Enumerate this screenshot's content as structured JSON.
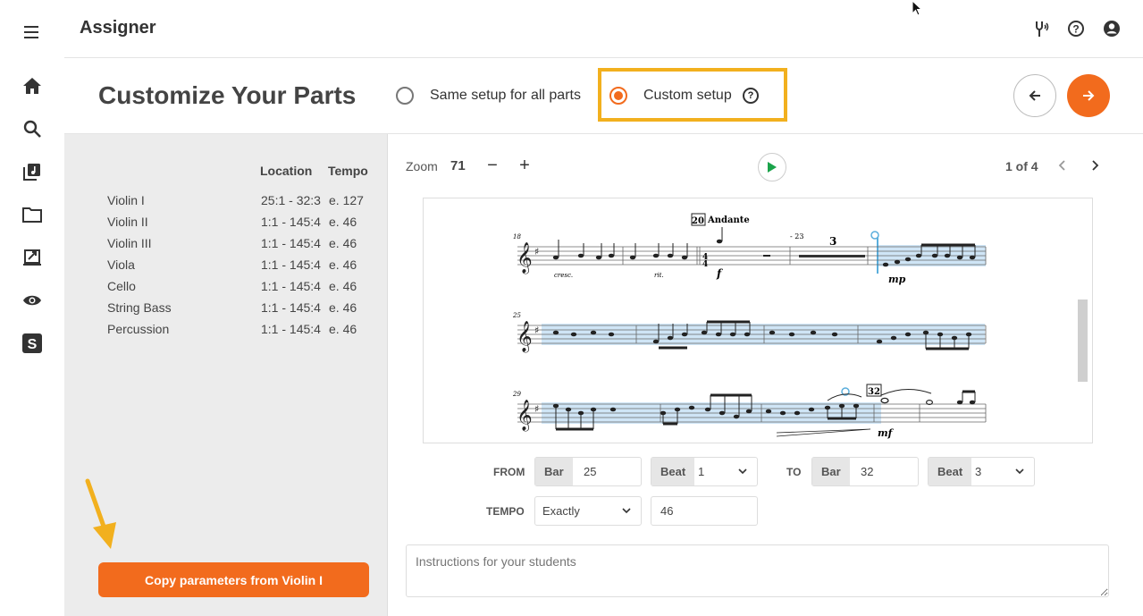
{
  "app": {
    "title": "Assigner"
  },
  "header": {
    "title": "Customize Your Parts",
    "option_same": "Same setup for all parts",
    "option_custom": "Custom setup",
    "help": "?",
    "selected": "custom"
  },
  "parts_table": {
    "headers": {
      "location": "Location",
      "tempo": "Tempo"
    },
    "rows": [
      {
        "name": "Violin I",
        "location": "25:1 - 32:3",
        "tempo": "e. 127"
      },
      {
        "name": "Violin II",
        "location": "1:1 - 145:4",
        "tempo": "e. 46"
      },
      {
        "name": "Violin III",
        "location": "1:1 - 145:4",
        "tempo": "e. 46"
      },
      {
        "name": "Viola",
        "location": "1:1 - 145:4",
        "tempo": "e. 46"
      },
      {
        "name": "Cello",
        "location": "1:1 - 145:4",
        "tempo": "e. 46"
      },
      {
        "name": "String Bass",
        "location": "1:1 - 145:4",
        "tempo": "e. 46"
      },
      {
        "name": "Percussion",
        "location": "1:1 - 145:4",
        "tempo": "e. 46"
      }
    ]
  },
  "copy_button": "Copy parameters from Violin I",
  "viewer": {
    "zoom_label": "Zoom",
    "zoom_value": "71",
    "zoom_minus": "−",
    "zoom_plus": "+",
    "page_indicator": "1 of 4",
    "score_labels": {
      "rehearsal_20": "20",
      "tempo_mark": "Andante",
      "bar_18": "18",
      "bar_25": "25",
      "bar_29": "29",
      "rehearsal_32": "32",
      "rest_count": "3",
      "rest_range": "- 23",
      "cresc": "cresc.",
      "rit": "rit.",
      "dyn_f": "f",
      "dyn_mp": "mp",
      "dyn_mf": "mf"
    }
  },
  "range": {
    "from_label": "FROM",
    "to_label": "TO",
    "bar_label": "Bar",
    "beat_label": "Beat",
    "from_bar": "25",
    "from_beat": "1",
    "to_bar": "32",
    "to_beat": "3",
    "tempo_label": "TEMPO",
    "tempo_mode": "Exactly",
    "tempo_value": "46"
  },
  "instructions": {
    "placeholder": "Instructions for your students"
  },
  "colors": {
    "accent": "#f26b1d",
    "highlight": "#f2b01e",
    "selection": "#cfe5f6"
  }
}
